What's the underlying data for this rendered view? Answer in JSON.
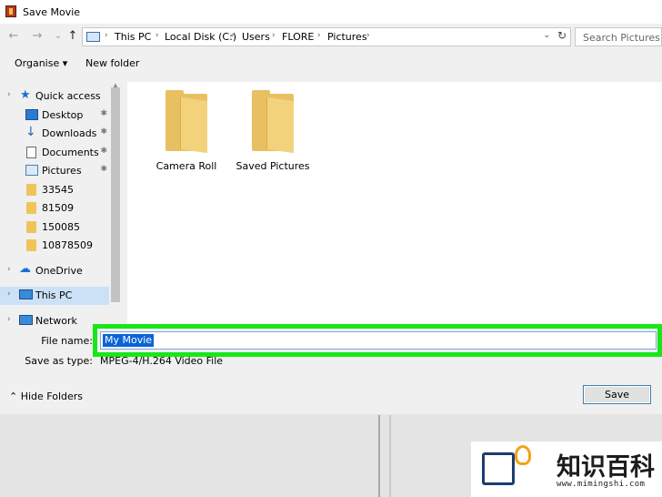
{
  "window": {
    "title": "Save Movie"
  },
  "nav": {
    "back": "←",
    "forward": "→",
    "recent": "⌄",
    "up": "↑"
  },
  "address": {
    "crumbs": [
      "This PC",
      "Local Disk (C:)",
      "Users",
      "FLORE",
      "Pictures"
    ],
    "separator": "›",
    "dropdown": "⌄",
    "refresh": "↻"
  },
  "search": {
    "placeholder": "Search Pictures"
  },
  "toolbar": {
    "organise": "Organise ▾",
    "new_folder": "New folder"
  },
  "sidebar": {
    "quick_access": "Quick access",
    "items": [
      {
        "label": "Desktop",
        "icon": "desktop-icon",
        "pinned": true
      },
      {
        "label": "Downloads",
        "icon": "downloads-icon",
        "pinned": true
      },
      {
        "label": "Documents",
        "icon": "documents-icon",
        "pinned": true
      },
      {
        "label": "Pictures",
        "icon": "pictures-icon",
        "pinned": true
      },
      {
        "label": "33545",
        "icon": "folder-icon"
      },
      {
        "label": "81509",
        "icon": "folder-icon"
      },
      {
        "label": "150085",
        "icon": "folder-icon"
      },
      {
        "label": "10878509",
        "icon": "folder-icon"
      }
    ],
    "onedrive": "OneDrive",
    "this_pc": "This PC",
    "network": "Network",
    "pin_glyph": "📌"
  },
  "folders": [
    {
      "label": "Camera Roll"
    },
    {
      "label": "Saved Pictures"
    }
  ],
  "form": {
    "file_name_label": "File name:",
    "file_name_value": "My Movie",
    "save_as_type_label": "Save as type:",
    "save_as_type_value": "MPEG-4/H.264 Video File"
  },
  "footer": {
    "hide_folders": "Hide Folders",
    "save": "Save"
  },
  "highlight_color": "#19e619",
  "watermark": {
    "chinese": "知识百科",
    "url": "www.mimingshi.com"
  }
}
